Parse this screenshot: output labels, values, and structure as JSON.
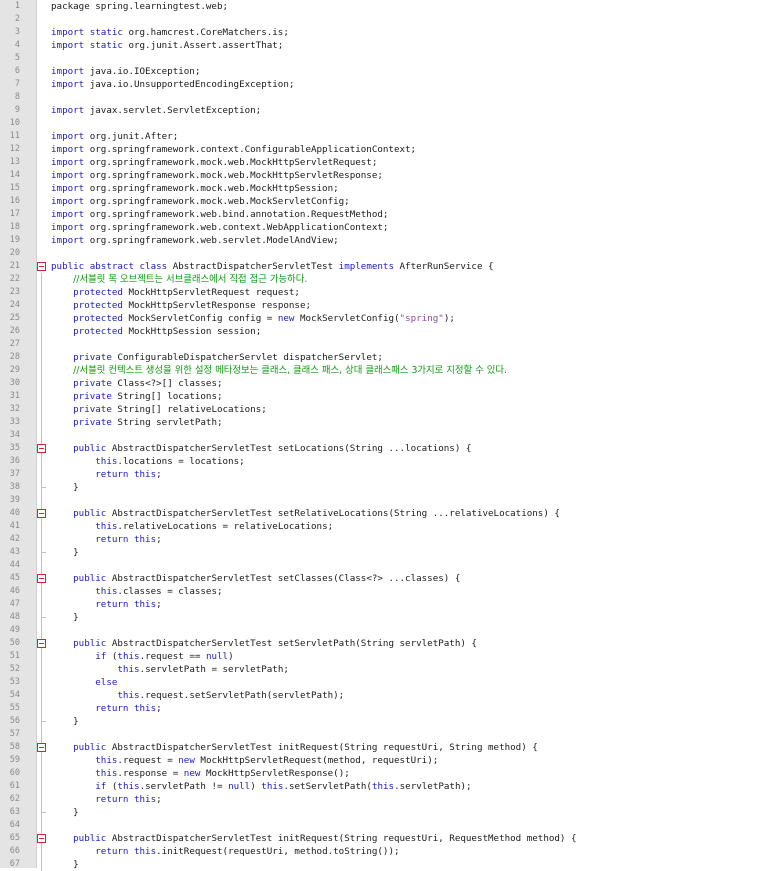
{
  "editor": {
    "foldable_lines": [
      21,
      35,
      40,
      45,
      50,
      58,
      65
    ],
    "fold_end_lines": [
      38,
      43,
      48,
      56,
      63
    ],
    "lines": [
      [
        [
          "package spring.learningtest.web;",
          ""
        ]
      ],
      [],
      [
        [
          "import static",
          "kw"
        ],
        [
          " org.hamcrest.CoreMatchers.is;",
          ""
        ]
      ],
      [
        [
          "import static",
          "kw"
        ],
        [
          " org.junit.Assert.assertThat;",
          ""
        ]
      ],
      [],
      [
        [
          "import",
          "kw"
        ],
        [
          " java.io.IOException;",
          ""
        ]
      ],
      [
        [
          "import",
          "kw"
        ],
        [
          " java.io.UnsupportedEncodingException;",
          ""
        ]
      ],
      [],
      [
        [
          "import",
          "kw"
        ],
        [
          " javax.servlet.ServletException;",
          ""
        ]
      ],
      [],
      [
        [
          "import",
          "kw"
        ],
        [
          " org.junit.After;",
          ""
        ]
      ],
      [
        [
          "import",
          "kw"
        ],
        [
          " org.springframework.context.ConfigurableApplicationContext;",
          ""
        ]
      ],
      [
        [
          "import",
          "kw"
        ],
        [
          " org.springframework.mock.web.MockHttpServletRequest;",
          ""
        ]
      ],
      [
        [
          "import",
          "kw"
        ],
        [
          " org.springframework.mock.web.MockHttpServletResponse;",
          ""
        ]
      ],
      [
        [
          "import",
          "kw"
        ],
        [
          " org.springframework.mock.web.MockHttpSession;",
          ""
        ]
      ],
      [
        [
          "import",
          "kw"
        ],
        [
          " org.springframework.mock.web.MockServletConfig;",
          ""
        ]
      ],
      [
        [
          "import",
          "kw"
        ],
        [
          " org.springframework.web.bind.annotation.RequestMethod;",
          ""
        ]
      ],
      [
        [
          "import",
          "kw"
        ],
        [
          " org.springframework.web.context.WebApplicationContext;",
          ""
        ]
      ],
      [
        [
          "import",
          "kw"
        ],
        [
          " org.springframework.web.servlet.ModelAndView;",
          ""
        ]
      ],
      [],
      [
        [
          "public abstract class",
          "kw"
        ],
        [
          " AbstractDispatcherServletTest ",
          ""
        ],
        [
          "implements",
          "kw"
        ],
        [
          " AfterRunService {",
          ""
        ]
      ],
      [
        [
          "    ",
          ""
        ],
        [
          "//서블릿 목 오브젝트는 서브클래스에서 직접 접근 가능하다.",
          "cmt"
        ]
      ],
      [
        [
          "    ",
          ""
        ],
        [
          "protected",
          "kw"
        ],
        [
          " MockHttpServletRequest request;",
          ""
        ]
      ],
      [
        [
          "    ",
          ""
        ],
        [
          "protected",
          "kw"
        ],
        [
          " MockHttpServletResponse response;",
          ""
        ]
      ],
      [
        [
          "    ",
          ""
        ],
        [
          "protected",
          "kw"
        ],
        [
          " MockServletConfig config = ",
          ""
        ],
        [
          "new",
          "kw"
        ],
        [
          " MockServletConfig(",
          ""
        ],
        [
          "\"spring\"",
          "str"
        ],
        [
          ");",
          ""
        ]
      ],
      [
        [
          "    ",
          ""
        ],
        [
          "protected",
          "kw"
        ],
        [
          " MockHttpSession session;",
          ""
        ]
      ],
      [],
      [
        [
          "    ",
          ""
        ],
        [
          "private",
          "kw"
        ],
        [
          " ConfigurableDispatcherServlet dispatcherServlet;",
          ""
        ]
      ],
      [
        [
          "    ",
          ""
        ],
        [
          "//서블릿 컨텍스트 생성을 위한 설정 메타정보는 클래스, 클래스 패스, 상대 클래스패스 3가지로 지정할 수 있다.",
          "cmt"
        ]
      ],
      [
        [
          "    ",
          ""
        ],
        [
          "private",
          "kw"
        ],
        [
          " Class<?>[] classes;",
          ""
        ]
      ],
      [
        [
          "    ",
          ""
        ],
        [
          "private",
          "kw"
        ],
        [
          " String[] locations;",
          ""
        ]
      ],
      [
        [
          "    ",
          ""
        ],
        [
          "private",
          "kw"
        ],
        [
          " String[] relativeLocations;",
          ""
        ]
      ],
      [
        [
          "    ",
          ""
        ],
        [
          "private",
          "kw"
        ],
        [
          " String servletPath;",
          ""
        ]
      ],
      [],
      [
        [
          "    ",
          ""
        ],
        [
          "public",
          "kw"
        ],
        [
          " AbstractDispatcherServletTest setLocations(String ...locations) {",
          ""
        ]
      ],
      [
        [
          "        ",
          ""
        ],
        [
          "this",
          "kw"
        ],
        [
          ".locations = locations;",
          ""
        ]
      ],
      [
        [
          "        ",
          ""
        ],
        [
          "return this",
          "kw"
        ],
        [
          ";",
          ""
        ]
      ],
      [
        [
          "    }",
          ""
        ]
      ],
      [],
      [
        [
          "    ",
          ""
        ],
        [
          "public",
          "kw"
        ],
        [
          " AbstractDispatcherServletTest setRelativeLocations(String ...relativeLocations) {",
          ""
        ]
      ],
      [
        [
          "        ",
          ""
        ],
        [
          "this",
          "kw"
        ],
        [
          ".relativeLocations = relativeLocations;",
          ""
        ]
      ],
      [
        [
          "        ",
          ""
        ],
        [
          "return this",
          "kw"
        ],
        [
          ";",
          ""
        ]
      ],
      [
        [
          "    }",
          ""
        ]
      ],
      [],
      [
        [
          "    ",
          ""
        ],
        [
          "public",
          "kw"
        ],
        [
          " AbstractDispatcherServletTest setClasses(Class<?> ...classes) {",
          ""
        ]
      ],
      [
        [
          "        ",
          ""
        ],
        [
          "this",
          "kw"
        ],
        [
          ".classes = classes;",
          ""
        ]
      ],
      [
        [
          "        ",
          ""
        ],
        [
          "return this",
          "kw"
        ],
        [
          ";",
          ""
        ]
      ],
      [
        [
          "    }",
          ""
        ]
      ],
      [],
      [
        [
          "    ",
          ""
        ],
        [
          "public",
          "kw"
        ],
        [
          " AbstractDispatcherServletTest setServletPath(String servletPath) {",
          ""
        ]
      ],
      [
        [
          "        ",
          ""
        ],
        [
          "if",
          "kw"
        ],
        [
          " (",
          ""
        ],
        [
          "this",
          "kw"
        ],
        [
          ".request == ",
          ""
        ],
        [
          "null",
          "kw"
        ],
        [
          ")",
          ""
        ]
      ],
      [
        [
          "            ",
          ""
        ],
        [
          "this",
          "kw"
        ],
        [
          ".servletPath = servletPath;",
          ""
        ]
      ],
      [
        [
          "        ",
          ""
        ],
        [
          "else",
          "kw"
        ]
      ],
      [
        [
          "            ",
          ""
        ],
        [
          "this",
          "kw"
        ],
        [
          ".request.setServletPath(servletPath);",
          ""
        ]
      ],
      [
        [
          "        ",
          ""
        ],
        [
          "return this",
          "kw"
        ],
        [
          ";",
          ""
        ]
      ],
      [
        [
          "    }",
          ""
        ]
      ],
      [],
      [
        [
          "    ",
          ""
        ],
        [
          "public",
          "kw"
        ],
        [
          " AbstractDispatcherServletTest initRequest(String requestUri, String method) {",
          ""
        ]
      ],
      [
        [
          "        ",
          ""
        ],
        [
          "this",
          "kw"
        ],
        [
          ".request = ",
          ""
        ],
        [
          "new",
          "kw"
        ],
        [
          " MockHttpServletRequest(method, requestUri);",
          ""
        ]
      ],
      [
        [
          "        ",
          ""
        ],
        [
          "this",
          "kw"
        ],
        [
          ".response = ",
          ""
        ],
        [
          "new",
          "kw"
        ],
        [
          " MockHttpServletResponse();",
          ""
        ]
      ],
      [
        [
          "        ",
          ""
        ],
        [
          "if",
          "kw"
        ],
        [
          " (",
          ""
        ],
        [
          "this",
          "kw"
        ],
        [
          ".servletPath != ",
          ""
        ],
        [
          "null",
          "kw"
        ],
        [
          ") ",
          ""
        ],
        [
          "this",
          "kw"
        ],
        [
          ".setServletPath(",
          ""
        ],
        [
          "this",
          "kw"
        ],
        [
          ".servletPath);",
          ""
        ]
      ],
      [
        [
          "        ",
          ""
        ],
        [
          "return this",
          "kw"
        ],
        [
          ";",
          ""
        ]
      ],
      [
        [
          "    }",
          ""
        ]
      ],
      [],
      [
        [
          "    ",
          ""
        ],
        [
          "public",
          "kw"
        ],
        [
          " AbstractDispatcherServletTest initRequest(String requestUri, RequestMethod method) {",
          ""
        ]
      ],
      [
        [
          "        ",
          ""
        ],
        [
          "return this",
          "kw"
        ],
        [
          ".initRequest(requestUri, method.toString());",
          ""
        ]
      ],
      [
        [
          "    }",
          ""
        ]
      ]
    ]
  }
}
